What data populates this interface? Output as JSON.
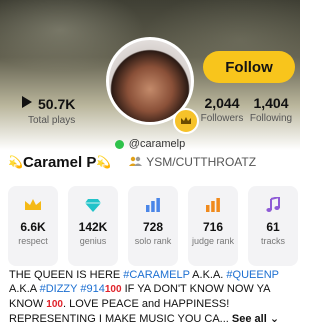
{
  "colors": {
    "accent": "#f8c51c",
    "hashtag": "#1c6fd1",
    "online": "#2ec24a",
    "card_bg": "#f3f3f5"
  },
  "profile": {
    "follow_label": "Follow",
    "plays": {
      "value": "50.7K",
      "label": "Total plays"
    },
    "followers": {
      "value": "2,044",
      "label": "Followers"
    },
    "following": {
      "value": "1,404",
      "label": "Following"
    },
    "handle": "@caramelp",
    "display_name": "Caramel P",
    "group": "YSM/CUTTHROATZ"
  },
  "stats": [
    {
      "icon": "crown-icon",
      "value": "6.6K",
      "label": "respect"
    },
    {
      "icon": "diamond-icon",
      "value": "142K",
      "label": "genius"
    },
    {
      "icon": "bar-chart-icon",
      "value": "728",
      "label": "solo rank"
    },
    {
      "icon": "bar-chart-icon",
      "value": "716",
      "label": "judge rank"
    },
    {
      "icon": "music-note-icon",
      "value": "61",
      "label": "tracks"
    }
  ],
  "bio": {
    "l1_a": "THE QUEEN IS HERE ",
    "l1_tag1": "#CARAMELP",
    "l1_b": "  A.K.A. ",
    "l1_tag2": "#QUEENP",
    "l2_a": "A.K.A ",
    "l2_tag1": "#DIZZY",
    "l2_sp": " ",
    "l2_tag2": "#914",
    "l2_hundred": "100",
    "l2_b": " IF YA DON'T KNOW NOW YA",
    "l3_a": "KNOW ",
    "l3_hundred": "100",
    "l3_b": ". LOVE  PEACE and HAPPINESS!",
    "l4_a": "REPRESENTING I MAKE MUSIC YOU CA...",
    "see_all": "See all"
  }
}
